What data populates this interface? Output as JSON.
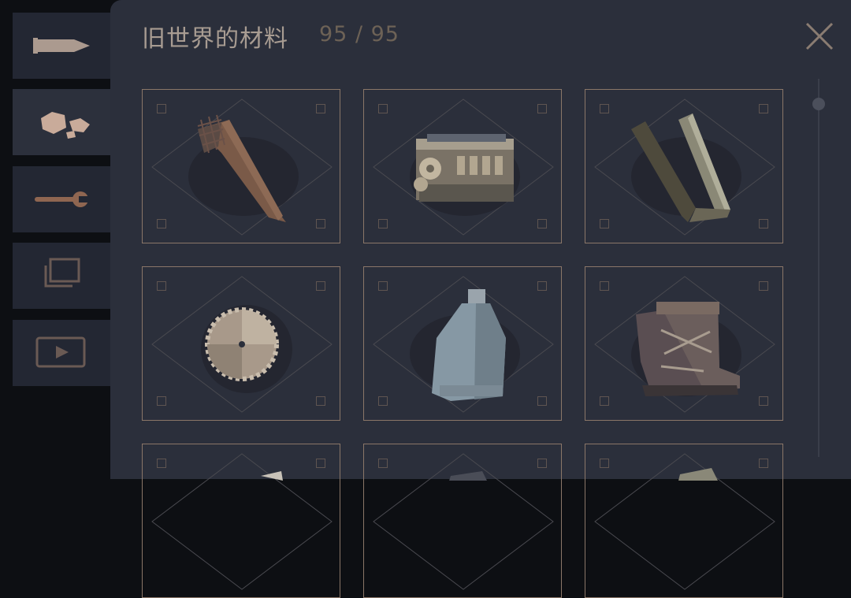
{
  "panel": {
    "title": "旧世界的材料",
    "count": "95 / 95"
  },
  "sidebar": {
    "tabs": [
      {
        "icon": "bullet-icon",
        "active": false
      },
      {
        "icon": "rocks-icon",
        "active": true
      },
      {
        "icon": "wrench-icon",
        "active": false
      },
      {
        "icon": "gallery-icon",
        "active": false
      },
      {
        "icon": "video-icon",
        "active": false
      }
    ]
  },
  "items": [
    {
      "icon": "rusty-drill-bit-icon"
    },
    {
      "icon": "engine-block-icon"
    },
    {
      "icon": "metal-brackets-icon"
    },
    {
      "icon": "saw-blade-icon"
    },
    {
      "icon": "metal-canister-icon"
    },
    {
      "icon": "worn-boot-icon"
    },
    {
      "icon": "item-partial-1-icon"
    },
    {
      "icon": "item-partial-2-icon"
    },
    {
      "icon": "item-partial-3-icon"
    }
  ],
  "colors": {
    "panel_bg": "#2b2f3b",
    "card_border": "#8a7668",
    "title": "#a89c92",
    "accent_tab": "#c9ab9a"
  }
}
